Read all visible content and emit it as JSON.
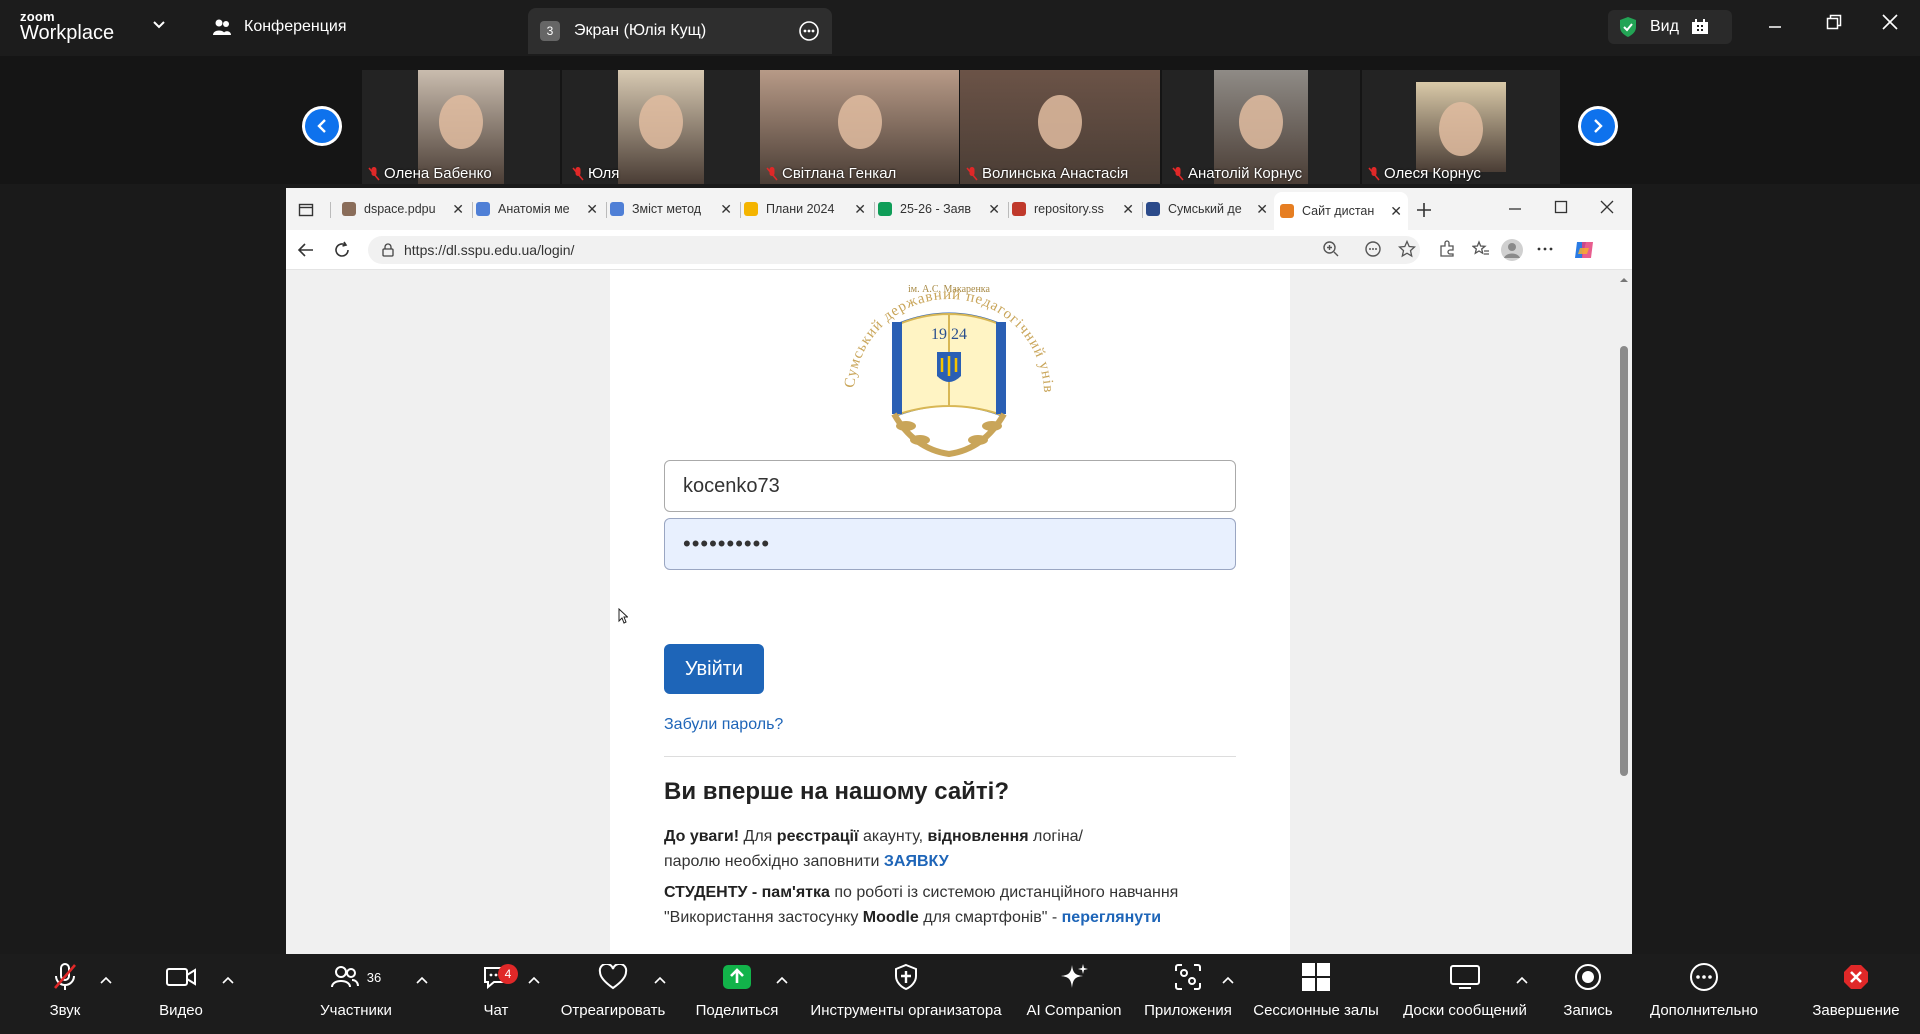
{
  "zoom": {
    "logo_small": "zoom",
    "logo_big": "Workplace",
    "conference_label": "Конференция",
    "screen_tab_num": "3",
    "screen_tab_label": "Экран (Юлія Кущ)",
    "view_label": "Вид"
  },
  "participants": [
    {
      "name": "Олена Бабенко",
      "tone": "#c9bcae"
    },
    {
      "name": "Юля",
      "tone": "#d7c9b2"
    },
    {
      "name": "Світлана Генкал",
      "tone": "#b79a87"
    },
    {
      "name": "Волинська Анастасія",
      "tone": "#6b5347"
    },
    {
      "name": "Анатолій Корнус",
      "tone": "#8f8b86"
    },
    {
      "name": "Олеся Корнус",
      "tone": "#d9c9a8"
    }
  ],
  "browser": {
    "tabs": [
      {
        "label": "dspace.pdpu",
        "color": "#8a6d5a"
      },
      {
        "label": "Анатомія ме",
        "color": "#4f7fd6"
      },
      {
        "label": "Зміст метод",
        "color": "#4f7fd6"
      },
      {
        "label": "Плани 2024",
        "color": "#f4b400"
      },
      {
        "label": "25-26 - Заяв",
        "color": "#0f9d58"
      },
      {
        "label": "repository.ss",
        "color": "#c0392b"
      },
      {
        "label": "Сумський де",
        "color": "#2b4a8a"
      },
      {
        "label": "Сайт дистан",
        "color": "#e67e22"
      }
    ],
    "url": "https://dl.sspu.edu.ua/login/"
  },
  "page": {
    "crest_top_text": "Сумський державний педагогічний університет",
    "crest_sub_text": "ім. А.С. Макаренка",
    "crest_year": "19 24",
    "username_value": "kocenko73",
    "password_mask": "••••••••••",
    "login_button": "Увійти",
    "forgot_link": "Забули пароль?",
    "first_time_heading": "Ви вперше на нашому сайті?",
    "attention_bold": "До уваги!",
    "attention_text1": " Для ",
    "registration_bold": "реєстрації",
    "attention_text2": " акаунту, ",
    "restore_bold": "відновлення",
    "attention_text3": " логіна/",
    "attention_line2": "паролю необхідно заповнити ",
    "request_link": "ЗАЯВКУ",
    "student_bold": "СТУДЕНТУ - пам'ятка",
    "student_text": " по роботі із системою дистанційного навчання",
    "student_line2_start": "\"Використання застосунку ",
    "moodle_bold": "Moodle",
    "student_line2_mid": " для смартфонів\" - ",
    "view_link": "переглянути"
  },
  "toolbar": {
    "items": [
      {
        "label": "Звук"
      },
      {
        "label": "Видео"
      },
      {
        "label": "Участники",
        "count": "36"
      },
      {
        "label": "Чат",
        "badge": "4"
      },
      {
        "label": "Отреагировать"
      },
      {
        "label": "Поделиться"
      },
      {
        "label": "Инструменты организатора"
      },
      {
        "label": "AI Companion"
      },
      {
        "label": "Приложения"
      },
      {
        "label": "Сессионные залы"
      },
      {
        "label": "Доски сообщений"
      },
      {
        "label": "Запись"
      },
      {
        "label": "Дополнительно"
      },
      {
        "label": "Завершение"
      }
    ]
  }
}
